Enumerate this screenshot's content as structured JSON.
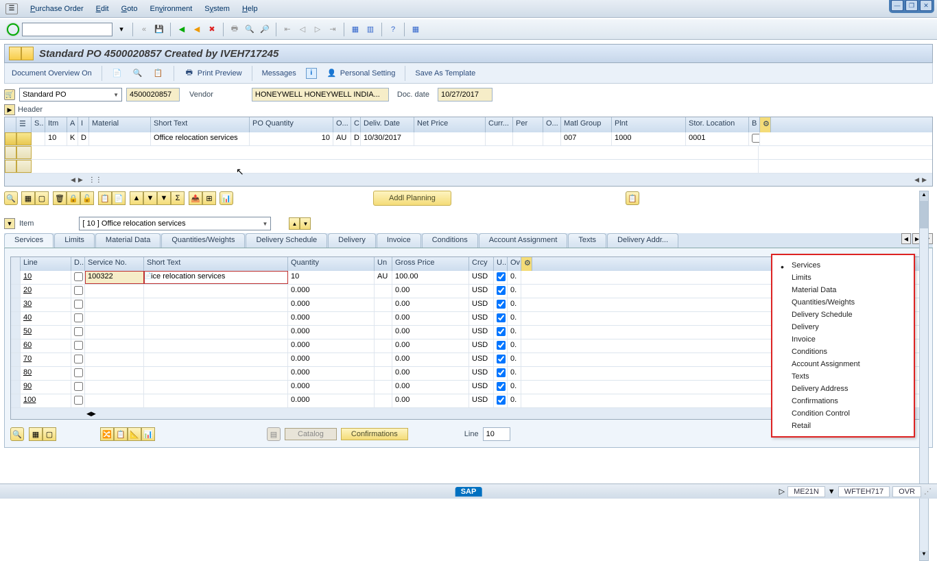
{
  "menu": {
    "items": [
      "Purchase Order",
      "Edit",
      "Goto",
      "Environment",
      "System",
      "Help"
    ]
  },
  "page_title": "Standard PO 4500020857 Created by IVEH717245",
  "app_toolbar": {
    "doc_overview": "Document Overview On",
    "print_preview": "Print Preview",
    "messages": "Messages",
    "personal_setting": "Personal Setting",
    "save_template": "Save As Template"
  },
  "doctype": {
    "type": "Standard PO",
    "number": "4500020857",
    "vendor_label": "Vendor",
    "vendor": "HONEYWELL HONEYWELL INDIA...",
    "doc_date_label": "Doc. date",
    "doc_date": "10/27/2017"
  },
  "header_label": "Header",
  "grid": {
    "cols": [
      "S..",
      "Itm",
      "A",
      "I",
      "Material",
      "Short Text",
      "PO Quantity",
      "O...",
      "C",
      "Deliv. Date",
      "Net Price",
      "Curr...",
      "Per",
      "O...",
      "Matl Group",
      "Plnt",
      "Stor. Location",
      "B"
    ],
    "rows": [
      {
        "s": "",
        "itm": "10",
        "a": "K",
        "i": "D",
        "material": "",
        "short": "Office relocation services",
        "qty": "10",
        "oun": "AU",
        "c": "D",
        "deliv": "10/30/2017",
        "net": "",
        "curr": "",
        "per": "",
        "o2": "",
        "matl": "007",
        "plnt": "1000",
        "stor": "0001",
        "b": ""
      }
    ]
  },
  "grid_toolbar": {
    "addl": "Addl Planning"
  },
  "item": {
    "label": "Item",
    "value": "[ 10 ] Office relocation services"
  },
  "tabs": [
    "Services",
    "Limits",
    "Material Data",
    "Quantities/Weights",
    "Delivery Schedule",
    "Delivery",
    "Invoice",
    "Conditions",
    "Account Assignment",
    "Texts",
    "Delivery Addr..."
  ],
  "svc_grid": {
    "cols": [
      "Line",
      "D..",
      "Service No.",
      "Short Text",
      "Quantity",
      "Un",
      "Gross Price",
      "Crcy",
      "U..",
      "Ov"
    ],
    "rows": [
      {
        "line": "10",
        "d": false,
        "sno": "100322",
        "short": "ice relocation services",
        "qty": "10",
        "un": "AU",
        "gp": "100.00",
        "crcy": "USD",
        "u": true,
        "ov": "0."
      },
      {
        "line": "20",
        "d": false,
        "sno": "",
        "short": "",
        "qty": "0.000",
        "un": "",
        "gp": "0.00",
        "crcy": "USD",
        "u": true,
        "ov": "0."
      },
      {
        "line": "30",
        "d": false,
        "sno": "",
        "short": "",
        "qty": "0.000",
        "un": "",
        "gp": "0.00",
        "crcy": "USD",
        "u": true,
        "ov": "0."
      },
      {
        "line": "40",
        "d": false,
        "sno": "",
        "short": "",
        "qty": "0.000",
        "un": "",
        "gp": "0.00",
        "crcy": "USD",
        "u": true,
        "ov": "0."
      },
      {
        "line": "50",
        "d": false,
        "sno": "",
        "short": "",
        "qty": "0.000",
        "un": "",
        "gp": "0.00",
        "crcy": "USD",
        "u": true,
        "ov": "0."
      },
      {
        "line": "60",
        "d": false,
        "sno": "",
        "short": "",
        "qty": "0.000",
        "un": "",
        "gp": "0.00",
        "crcy": "USD",
        "u": true,
        "ov": "0."
      },
      {
        "line": "70",
        "d": false,
        "sno": "",
        "short": "",
        "qty": "0.000",
        "un": "",
        "gp": "0.00",
        "crcy": "USD",
        "u": true,
        "ov": "0."
      },
      {
        "line": "80",
        "d": false,
        "sno": "",
        "short": "",
        "qty": "0.000",
        "un": "",
        "gp": "0.00",
        "crcy": "USD",
        "u": true,
        "ov": "0."
      },
      {
        "line": "90",
        "d": false,
        "sno": "",
        "short": "",
        "qty": "0.000",
        "un": "",
        "gp": "0.00",
        "crcy": "USD",
        "u": true,
        "ov": "0."
      },
      {
        "line": "100",
        "d": false,
        "sno": "",
        "short": "",
        "qty": "0.000",
        "un": "",
        "gp": "0.00",
        "crcy": "USD",
        "u": true,
        "ov": "0."
      }
    ]
  },
  "bottom": {
    "catalog": "Catalog",
    "confirmations": "Confirmations",
    "line_label": "Line",
    "line_value": "10"
  },
  "tab_menu": [
    "Services",
    "Limits",
    "Material Data",
    "Quantities/Weights",
    "Delivery Schedule",
    "Delivery",
    "Invoice",
    "Conditions",
    "Account Assignment",
    "Texts",
    "Delivery Address",
    "Confirmations",
    "Condition Control",
    "Retail"
  ],
  "status": {
    "sap": "SAP",
    "tcode": "ME21N",
    "user": "WFTEH717",
    "mode": "OVR"
  }
}
